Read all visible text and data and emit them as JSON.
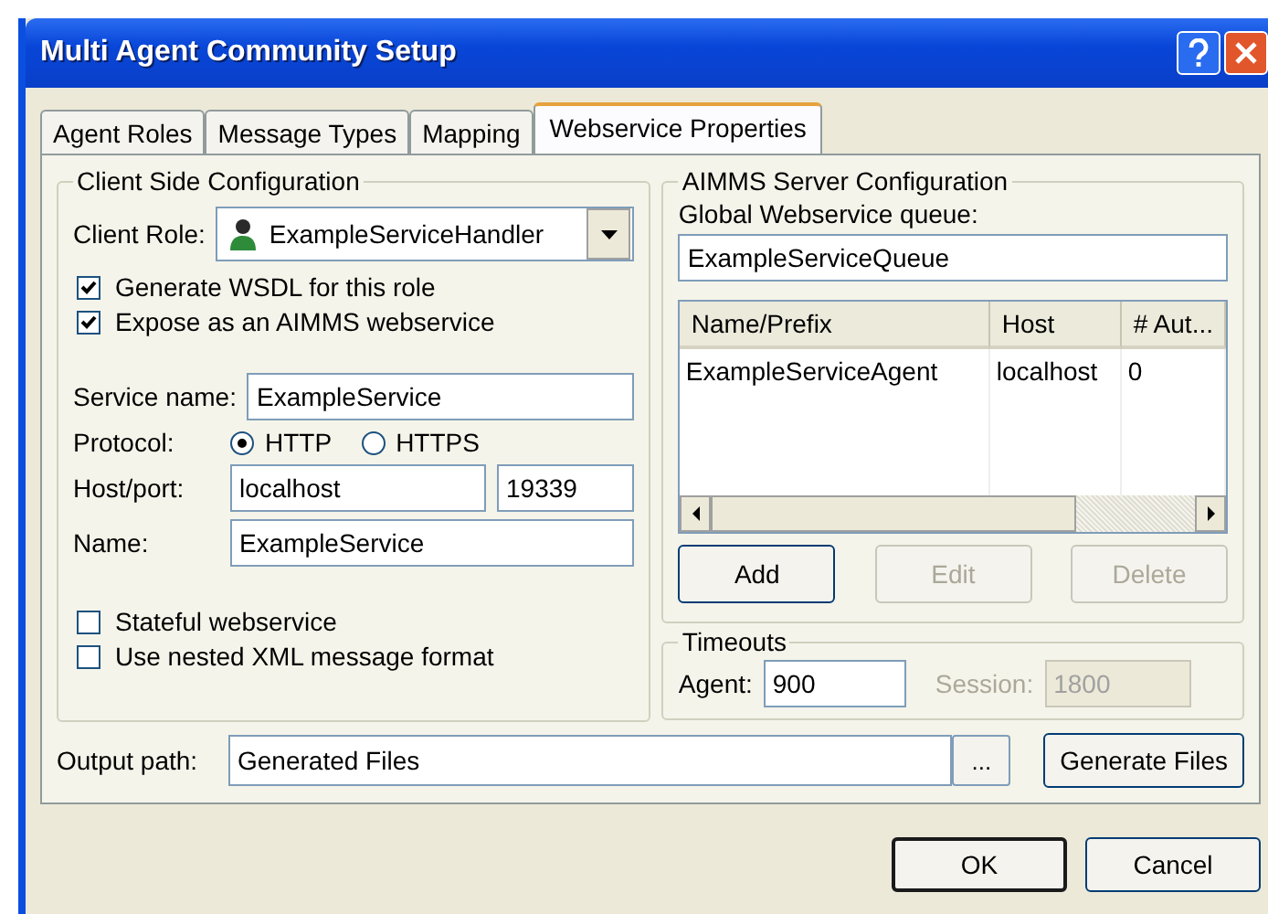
{
  "window": {
    "title": "Multi Agent Community Setup"
  },
  "tabs": [
    {
      "label": "Agent Roles",
      "selected": false
    },
    {
      "label": "Message Types",
      "selected": false
    },
    {
      "label": "Mapping",
      "selected": false
    },
    {
      "label": "Webservice Properties",
      "selected": true
    }
  ],
  "client_side": {
    "title": "Client Side Configuration",
    "client_role": {
      "label": "Client Role:",
      "value": "ExampleServiceHandler"
    },
    "options": [
      {
        "label": "Generate WSDL for this role",
        "checked": true
      },
      {
        "label": "Expose as an AIMMS webservice",
        "checked": true
      }
    ],
    "service_name": {
      "label": "Service name:",
      "value": "ExampleService"
    },
    "protocol": {
      "label": "Protocol:",
      "options": [
        {
          "label": "HTTP",
          "selected": true
        },
        {
          "label": "HTTPS",
          "selected": false
        }
      ]
    },
    "host_port": {
      "label": "Host/port:",
      "host": "localhost",
      "port": "19339"
    },
    "name": {
      "label": "Name:",
      "value": "ExampleService"
    },
    "flags": [
      {
        "label": "Stateful webservice",
        "checked": false
      },
      {
        "label": "Use nested XML message format",
        "checked": false
      }
    ]
  },
  "server": {
    "title": "AIMMS Server Configuration",
    "queue": {
      "label": "Global Webservice queue:",
      "value": "ExampleServiceQueue"
    },
    "table": {
      "columns": [
        "Name/Prefix",
        "Host",
        "# Aut..."
      ],
      "rows": [
        [
          "ExampleServiceAgent",
          "localhost",
          "0"
        ]
      ]
    },
    "buttons": [
      {
        "label": "Add",
        "disabled": false
      },
      {
        "label": "Edit",
        "disabled": true
      },
      {
        "label": "Delete",
        "disabled": true
      }
    ]
  },
  "timeouts": {
    "title": "Timeouts",
    "agent": {
      "label": "Agent:",
      "value": "900",
      "disabled": false
    },
    "session": {
      "label": "Session:",
      "value": "1800",
      "disabled": true
    }
  },
  "output": {
    "label": "Output path:",
    "value": "Generated Files",
    "browse": "...",
    "generate": "Generate Files"
  },
  "buttons": [
    {
      "label": "OK",
      "default": true
    },
    {
      "label": "Cancel",
      "default": false
    }
  ]
}
